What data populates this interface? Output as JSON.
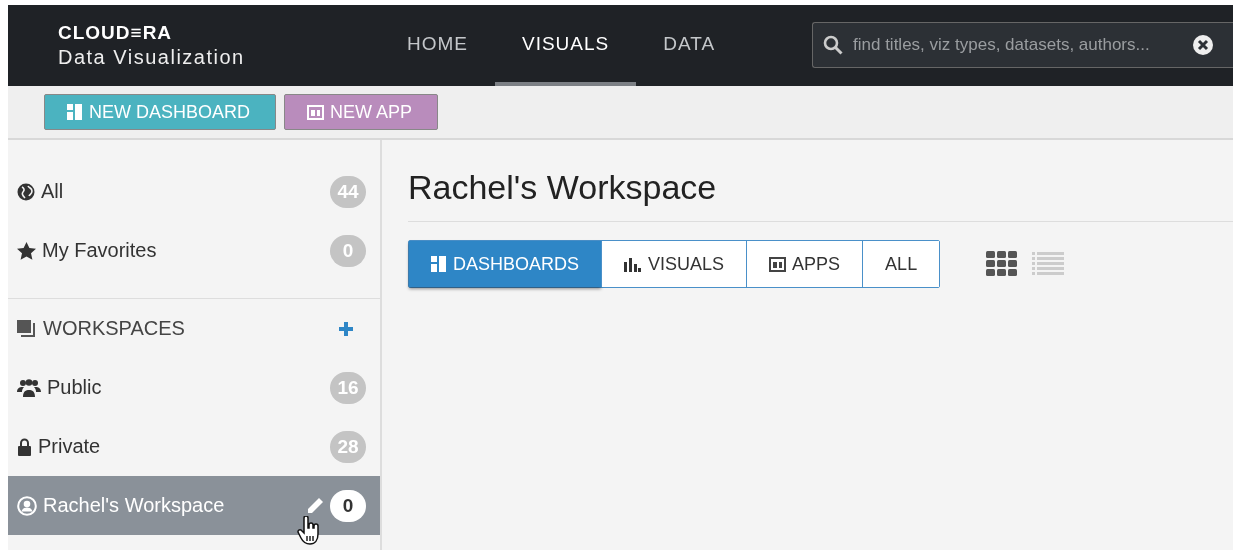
{
  "logo": {
    "brand": "CLOUD≡RA",
    "product": "Data Visualization"
  },
  "nav": [
    {
      "label": "HOME",
      "selected": false
    },
    {
      "label": "VISUALS",
      "selected": true
    },
    {
      "label": "DATA",
      "selected": false
    }
  ],
  "search": {
    "placeholder": "find titles, viz types, datasets, authors..."
  },
  "actions": [
    {
      "label": "NEW DASHBOARD",
      "kind": "dashboard"
    },
    {
      "label": "NEW APP",
      "kind": "app"
    }
  ],
  "sidebar": {
    "items": [
      {
        "kind": "item",
        "label": "All",
        "count": "44",
        "selected": false
      },
      {
        "kind": "item",
        "label": "My Favorites",
        "count": "0",
        "selected": false
      },
      {
        "kind": "header",
        "label": "WORKSPACES"
      },
      {
        "kind": "item",
        "label": "Public",
        "count": "16",
        "selected": false
      },
      {
        "kind": "item",
        "label": "Private",
        "count": "28",
        "selected": false
      },
      {
        "kind": "item",
        "label": "Rachel's Workspace",
        "count": "0",
        "selected": true
      }
    ]
  },
  "main": {
    "title": "Rachel's Workspace",
    "tabs": [
      {
        "label": "DASHBOARDS",
        "selected": true
      },
      {
        "label": "VISUALS",
        "selected": false
      },
      {
        "label": "APPS",
        "selected": false
      },
      {
        "label": "ALL",
        "selected": false
      }
    ],
    "views": [
      {
        "kind": "grid",
        "selected": true
      },
      {
        "kind": "list",
        "selected": false
      }
    ]
  }
}
